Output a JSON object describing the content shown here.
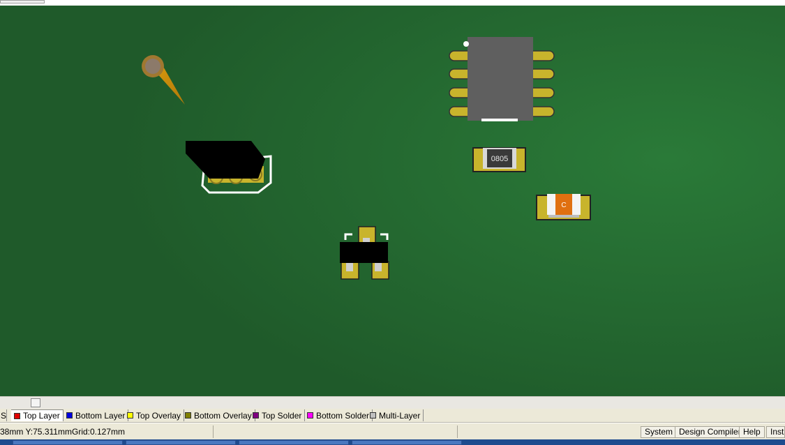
{
  "layer_tabs": [
    {
      "label": "Top Layer",
      "color": "#e00000"
    },
    {
      "label": "Bottom Layer",
      "color": "#0000e0"
    },
    {
      "label": "Top Overlay",
      "color": "#ffff00"
    },
    {
      "label": "Bottom Overlay",
      "color": "#808000"
    },
    {
      "label": "Top Solder",
      "color": "#800080"
    },
    {
      "label": "Bottom Solder",
      "color": "#ff00ff"
    },
    {
      "label": "Multi-Layer",
      "color": "#c0c0c0"
    }
  ],
  "left_tab_fragment": "S",
  "status": {
    "coordinates": "38mm Y:75.311mm",
    "grid": "Grid:0.127mm"
  },
  "panel_buttons": [
    "System",
    "Design Compiler",
    "Help",
    "Instr"
  ],
  "board": {
    "background_color": "#1f5a2a",
    "pad_color": "#c8b42c",
    "overlay_color": "#ffffff",
    "resistor_label": "0805",
    "capacitor_label": "C"
  }
}
